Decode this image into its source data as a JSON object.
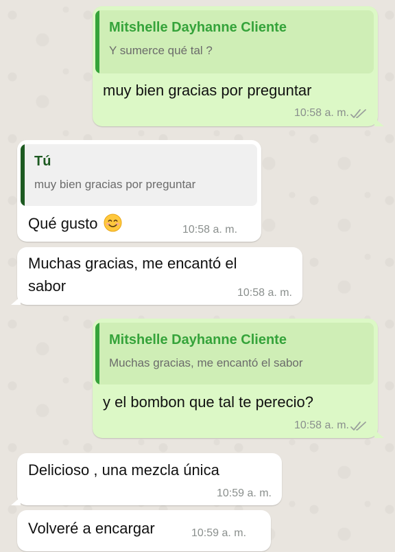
{
  "colors": {
    "outgoing_bubble": "#dcf8c6",
    "incoming_bubble": "#ffffff",
    "quote_accent_outgoing": "#35a33a",
    "quote_accent_incoming": "#1d5a21",
    "chat_background": "#e9e5df",
    "timestamp": "#8a8f8d"
  },
  "messages": [
    {
      "direction": "outgoing",
      "reply_to": {
        "name": "Mitshelle Dayhanne Cliente",
        "text": "Y sumerce qué tal ?"
      },
      "text": "muy bien gracias por preguntar",
      "time": "10:58 a. m.",
      "status_icon": "double-check-icon"
    },
    {
      "direction": "incoming",
      "reply_to": {
        "name": "Tú",
        "text": "muy bien gracias por preguntar"
      },
      "text": "Qué gusto",
      "emoji": "smiling-face-icon",
      "time": "10:58 a. m."
    },
    {
      "direction": "incoming",
      "text_line1": "Muchas gracias, me encantó el",
      "text_line2": "sabor",
      "time": "10:58 a. m."
    },
    {
      "direction": "outgoing",
      "reply_to": {
        "name": "Mitshelle Dayhanne Cliente",
        "text": "Muchas gracias, me encantó el sabor"
      },
      "text": "y el bombon que tal te perecio?",
      "time": "10:58 a. m.",
      "status_icon": "double-check-icon"
    },
    {
      "direction": "incoming",
      "text": "Delicioso , una mezcla única",
      "time": "10:59 a. m."
    },
    {
      "direction": "incoming",
      "text": "Volveré a encargar",
      "time": "10:59 a. m."
    }
  ]
}
